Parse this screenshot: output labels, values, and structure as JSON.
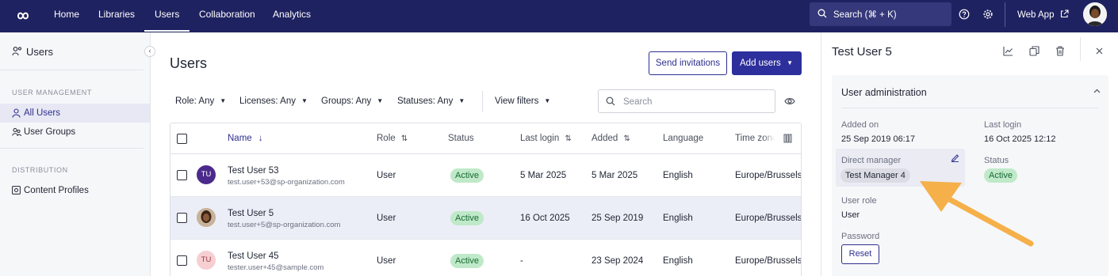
{
  "topnav": {
    "items": [
      "Home",
      "Libraries",
      "Users",
      "Collaboration",
      "Analytics"
    ],
    "active": "Users",
    "search_label": "Search (⌘ + K)",
    "webapp_label": "Web App",
    "brand_color": "#1f2260"
  },
  "sidebar": {
    "title": "Users",
    "sections": [
      {
        "heading": "USER MANAGEMENT",
        "items": [
          {
            "label": "All Users",
            "active": true,
            "icon": "user-icon"
          },
          {
            "label": "User Groups",
            "active": false,
            "icon": "user-group-icon"
          }
        ]
      },
      {
        "heading": "DISTRIBUTION",
        "items": [
          {
            "label": "Content Profiles",
            "active": false,
            "icon": "profile-icon"
          }
        ]
      }
    ]
  },
  "main": {
    "title": "Users",
    "send_invitations": "Send invitations",
    "add_users": "Add users",
    "filters": [
      "Role: Any",
      "Licenses: Any",
      "Groups: Any",
      "Statuses: Any"
    ],
    "view_filters": "View filters",
    "search_placeholder": "Search"
  },
  "table": {
    "columns": [
      "Name",
      "Role",
      "Status",
      "Last login",
      "Added",
      "Language",
      "Time zone"
    ],
    "rows": [
      {
        "initials": "TU",
        "name": "Test User 53",
        "email": "test.user+53@sp-organization.com",
        "role": "User",
        "status": "Active",
        "last_login": "5 Mar 2025",
        "added": "5 Mar 2025",
        "language": "English",
        "timezone": "Europe/Brussels",
        "avatar_color": "#4b2a8c",
        "selected": false
      },
      {
        "initials": "",
        "name": "Test User 5",
        "email": "test.user+5@sp-organization.com",
        "role": "User",
        "status": "Active",
        "last_login": "16 Oct 2025",
        "added": "25 Sep 2019",
        "language": "English",
        "timezone": "Europe/Brussels",
        "avatar_color": "#5a3a2a",
        "selected": true
      },
      {
        "initials": "TU",
        "name": "Test User 45",
        "email": "tester.user+45@sample.com",
        "role": "User",
        "status": "Active",
        "last_login": "-",
        "added": "23 Sep 2024",
        "language": "English",
        "timezone": "Europe/Brussels",
        "avatar_color": "#f6cfd2",
        "selected": false
      }
    ]
  },
  "panel": {
    "title": "Test User 5",
    "section": "User administration",
    "added_on_label": "Added on",
    "added_on": "25 Sep 2019 06:17",
    "last_login_label": "Last login",
    "last_login": "16 Oct 2025 12:12",
    "manager_label": "Direct manager",
    "manager": "Test Manager 4",
    "status_label": "Status",
    "status": "Active",
    "role_label": "User role",
    "role": "User",
    "password_label": "Password",
    "reset_label": "Reset"
  }
}
